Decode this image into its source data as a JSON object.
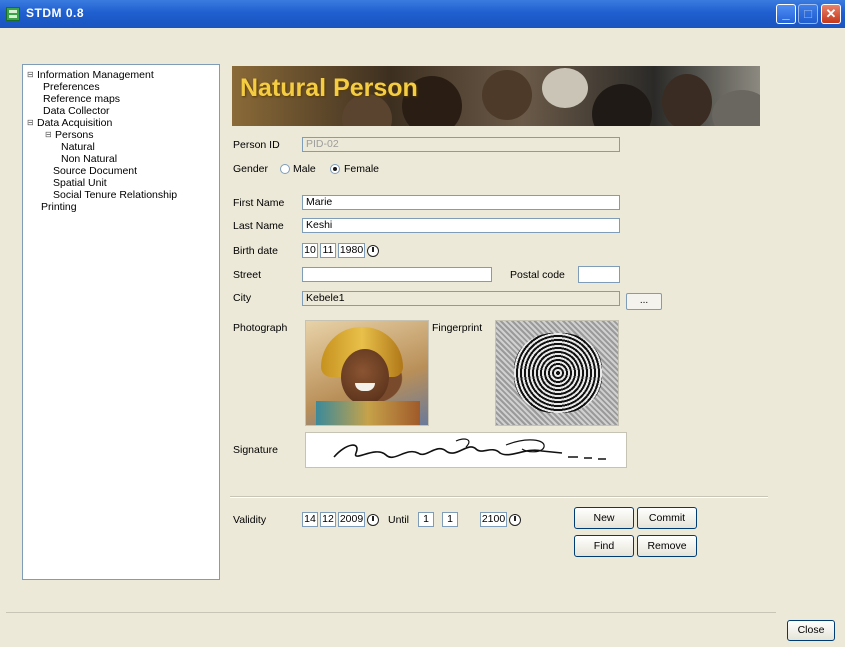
{
  "window": {
    "title": "STDM 0.8"
  },
  "tree": {
    "items": [
      {
        "label": "Information Management"
      },
      {
        "label": "Preferences"
      },
      {
        "label": "Reference maps"
      },
      {
        "label": "Data Collector"
      },
      {
        "label": "Data Acquisition"
      },
      {
        "label": "Persons"
      },
      {
        "label": "Natural"
      },
      {
        "label": "Non Natural"
      },
      {
        "label": "Source Document"
      },
      {
        "label": "Spatial Unit"
      },
      {
        "label": "Social Tenure Relationship"
      },
      {
        "label": "Printing"
      }
    ]
  },
  "form": {
    "banner_title": "Natural Person",
    "person_id": {
      "label": "Person ID",
      "value": "PID-02"
    },
    "gender": {
      "label": "Gender",
      "options": [
        "Male",
        "Female"
      ],
      "selected": "Female"
    },
    "first_name": {
      "label": "First Name",
      "value": "Marie"
    },
    "last_name": {
      "label": "Last Name",
      "value": "Keshi"
    },
    "birth_date": {
      "label": "Birth date",
      "day": "10",
      "month": "11",
      "year": "1980"
    },
    "street": {
      "label": "Street",
      "value": ""
    },
    "postal_code": {
      "label": "Postal code",
      "value": ""
    },
    "city": {
      "label": "City",
      "value": "Kebele1",
      "browse_label": "..."
    },
    "photograph": {
      "label": "Photograph"
    },
    "fingerprint": {
      "label": "Fingerprint"
    },
    "signature": {
      "label": "Signature"
    },
    "validity": {
      "label": "Validity",
      "from": {
        "day": "14",
        "month": "12",
        "year": "2009"
      },
      "until_label": "Until",
      "until": {
        "day": "1",
        "month": "1",
        "year": "2100"
      }
    },
    "buttons": {
      "new": "New",
      "commit": "Commit",
      "find": "Find",
      "remove": "Remove"
    }
  },
  "footer": {
    "close_label": "Close"
  },
  "colors": {
    "titlebar": "#1f5fcf",
    "banner_text": "#f5cd43",
    "window_bg": "#ece9d8"
  }
}
